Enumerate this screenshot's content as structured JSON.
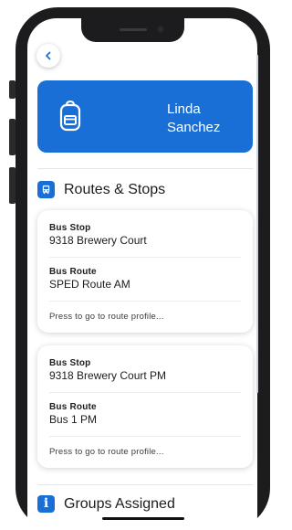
{
  "profile": {
    "first_name": "Linda",
    "last_name": "Sanchez"
  },
  "routes_section": {
    "title": "Routes & Stops"
  },
  "cards": [
    {
      "stop_label": "Bus Stop",
      "stop_value": "9318 Brewery Court",
      "route_label": "Bus Route",
      "route_value": "SPED Route AM",
      "hint": "Press to go to route profile..."
    },
    {
      "stop_label": "Bus Stop",
      "stop_value": "9318 Brewery Court PM",
      "route_label": "Bus Route",
      "route_value": "Bus 1 PM",
      "hint": "Press to go to route profile..."
    }
  ],
  "groups_section": {
    "title": "Groups Assigned"
  },
  "colors": {
    "accent": "#1a6fd6",
    "frame": "#1c1c1e"
  },
  "icons": [
    "back-chevron-icon",
    "backpack-icon",
    "bus-icon",
    "info-icon"
  ]
}
